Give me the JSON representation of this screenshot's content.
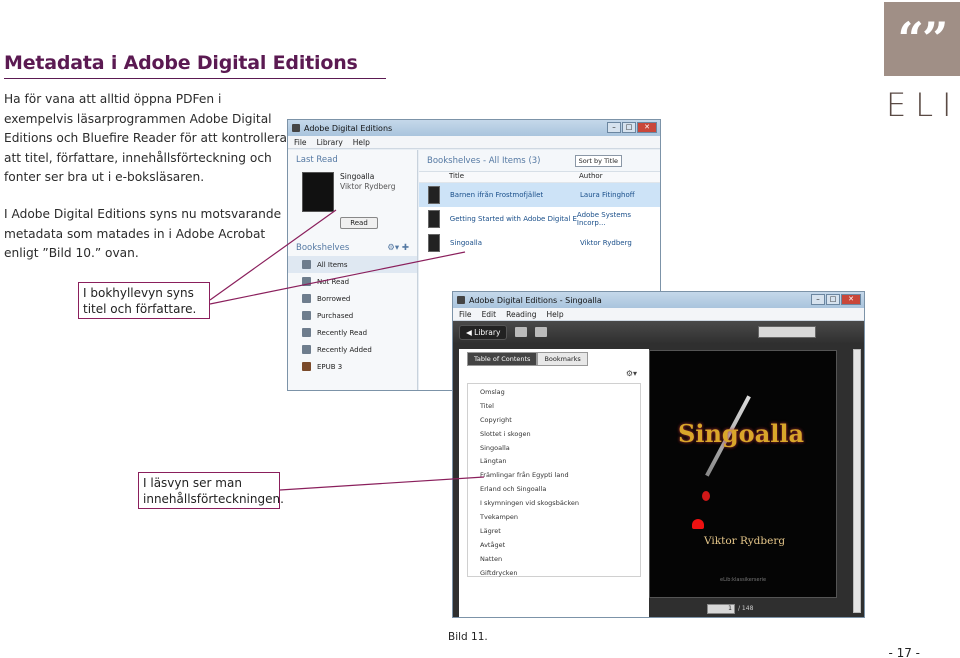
{
  "heading": "Metadata i Adobe Digital Editions",
  "paragraph1": "Ha för vana att alltid öppna PDFen i exempelvis läsarprogrammen Adobe Digital Editions och Bluefire Reader för att kontrollera att titel, författare, innehållsförteckning och fonter ser bra ut i e-boksläsaren.",
  "paragraph2": "I Adobe Digital Editions syns nu motsvarande metadata som matades in i Adobe Acrobat enligt ”Bild 10.” ovan.",
  "logo": {
    "quote_mark": "“”",
    "text": "ELIB",
    "bg_color": "#a08f86"
  },
  "callouts": {
    "bookshelf": "I bokhyllevyn syns titel och författare.",
    "reader": "I läsvyn ser man innehållsförteckningen."
  },
  "library_window": {
    "title": "Adobe Digital Editions",
    "menu": [
      "File",
      "Library",
      "Help"
    ],
    "last_read_heading": "Last Read",
    "last_read_title": "Singoalla",
    "last_read_author": "Viktor Rydberg",
    "read_button": "Read",
    "bookshelves_heading": "Bookshelves",
    "shelves": [
      "All Items",
      "Not Read",
      "Borrowed",
      "Purchased",
      "Recently Read",
      "Recently Added",
      "EPUB 3"
    ],
    "list_heading": "Bookshelves - All Items (3)",
    "sort_label": "Sort by Title",
    "col_title": "Title",
    "col_author": "Author",
    "books": [
      {
        "title": "Barnen ifrån Frostmofjället",
        "author": "Laura Fitinghoff"
      },
      {
        "title": "Getting Started with Adobe Digital Edi...",
        "author": "Adobe Systems Incorp..."
      },
      {
        "title": "Singoalla",
        "author": "Viktor Rydberg"
      }
    ]
  },
  "reader_window": {
    "title": "Adobe Digital Editions - Singoalla",
    "menu": [
      "File",
      "Edit",
      "Reading",
      "Help"
    ],
    "library_button": "◀ Library",
    "tab_toc": "Table of Contents",
    "tab_bookmarks": "Bookmarks",
    "toc": [
      "Omslag",
      "Titel",
      "Copyright",
      "Slottet i skogen",
      "Singoalla",
      "Längtan",
      "Främlingar från Egypti land",
      "Erland och Singoalla",
      "I skymningen vid skogsbäcken",
      "Tvekampen",
      "Lägret",
      "Avtåget",
      "Natten",
      "Giftdrycken"
    ],
    "cover_title": "Singoalla",
    "cover_author": "Viktor Rydberg",
    "cover_publisher": "eLib:klassikerserie",
    "page_current": "1",
    "page_total": "/ 148"
  },
  "caption": "Bild 11.",
  "page_number": "- 17 -"
}
